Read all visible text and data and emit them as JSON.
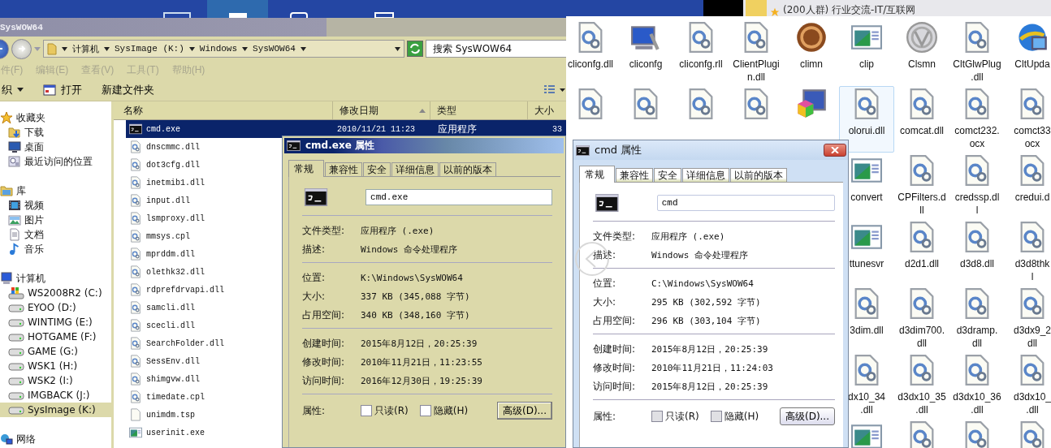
{
  "taskbar": {
    "notification": "(200人群) 行业交流-IT/互联网"
  },
  "explorer": {
    "title": "SysWOW64",
    "breadcrumbs": [
      "计算机",
      "SysImage (K:)",
      "Windows",
      "SysWOW64"
    ],
    "search": {
      "placeholder": "搜索 SysWOW64"
    },
    "menu": [
      {
        "label": "件(F)",
        "disabled": true
      },
      {
        "label": "编辑(E)",
        "disabled": true
      },
      {
        "label": "查看(V)",
        "disabled": true
      },
      {
        "label": "工具(T)",
        "disabled": true
      },
      {
        "label": "帮助(H)",
        "disabled": true
      }
    ],
    "toolbar": [
      {
        "label": "织",
        "kind": "dropdown"
      },
      {
        "label": "打开",
        "kind": "open"
      },
      {
        "label": "新建文件夹",
        "kind": "plain"
      }
    ],
    "nav": [
      {
        "label": "收藏夹",
        "kind": "favorites",
        "selected": false,
        "children": [
          {
            "label": "下载",
            "kind": "download",
            "selected": false
          },
          {
            "label": "桌面",
            "kind": "desktop",
            "selected": false
          },
          {
            "label": "最近访问的位置",
            "kind": "recent",
            "selected": false
          }
        ]
      },
      {
        "label": "库",
        "kind": "library",
        "selected": false,
        "children": [
          {
            "label": "视频",
            "kind": "video",
            "selected": false
          },
          {
            "label": "图片",
            "kind": "picture",
            "selected": false
          },
          {
            "label": "文档",
            "kind": "document",
            "selected": false
          },
          {
            "label": "音乐",
            "kind": "music",
            "selected": false
          }
        ]
      },
      {
        "label": "计算机",
        "kind": "computer",
        "selected": false,
        "children": [
          {
            "label": "WS2008R2 (C:)",
            "kind": "sysdrive",
            "selected": false
          },
          {
            "label": "EYOO (D:)",
            "kind": "drive",
            "selected": false
          },
          {
            "label": "WINTIMG (E:)",
            "kind": "drive",
            "selected": false
          },
          {
            "label": "HOTGAME (F:)",
            "kind": "drive",
            "selected": false
          },
          {
            "label": "GAME (G:)",
            "kind": "drive",
            "selected": false
          },
          {
            "label": "WSK1 (H:)",
            "kind": "drive",
            "selected": false
          },
          {
            "label": "WSK2 (I:)",
            "kind": "drive",
            "selected": false
          },
          {
            "label": "IMGBACK (J:)",
            "kind": "drive",
            "selected": false
          },
          {
            "label": "SysImage (K:)",
            "kind": "drive",
            "selected": true
          }
        ]
      },
      {
        "label": "网络",
        "kind": "network",
        "selected": false
      }
    ],
    "columns": [
      {
        "label": "名称",
        "sorted": false
      },
      {
        "label": "修改日期",
        "sorted": true
      },
      {
        "label": "类型",
        "sorted": false
      },
      {
        "label": "大小",
        "sorted": false
      }
    ],
    "files": [
      {
        "name": "cmd.exe",
        "kind": "console",
        "selected": true,
        "date": "2010/11/21 11:23",
        "type": "应用程序",
        "size": "33"
      },
      {
        "name": "dnscmmc.dll",
        "kind": "dll",
        "selected": false
      },
      {
        "name": "dot3cfg.dll",
        "kind": "dll",
        "selected": false
      },
      {
        "name": "inetmib1.dll",
        "kind": "dll",
        "selected": false
      },
      {
        "name": "input.dll",
        "kind": "dll",
        "selected": false
      },
      {
        "name": "lsmproxy.dll",
        "kind": "dll",
        "selected": false
      },
      {
        "name": "mmsys.cpl",
        "kind": "dll",
        "selected": false
      },
      {
        "name": "mprddm.dll",
        "kind": "dll",
        "selected": false
      },
      {
        "name": "olethk32.dll",
        "kind": "dll",
        "selected": false
      },
      {
        "name": "rdprefdrvapi.dll",
        "kind": "dll",
        "selected": false
      },
      {
        "name": "samcli.dll",
        "kind": "dll",
        "selected": false
      },
      {
        "name": "scecli.dll",
        "kind": "dll",
        "selected": false
      },
      {
        "name": "SearchFolder.dll",
        "kind": "dll",
        "selected": false
      },
      {
        "name": "SessEnv.dll",
        "kind": "dll",
        "selected": false
      },
      {
        "name": "shimgvw.dll",
        "kind": "dll",
        "selected": false
      },
      {
        "name": "timedate.cpl",
        "kind": "dll",
        "selected": false
      },
      {
        "name": "unimdm.tsp",
        "kind": "blank",
        "selected": false
      },
      {
        "name": "userinit.exe",
        "kind": "window",
        "selected": false
      }
    ]
  },
  "dialogs": [
    {
      "kind": "classic",
      "title": "cmd.exe 属性",
      "tabs": [
        {
          "label": "常规",
          "selected": true
        },
        {
          "label": "兼容性",
          "selected": false
        },
        {
          "label": "安全",
          "selected": false
        },
        {
          "label": "详细信息",
          "selected": false
        },
        {
          "label": "以前的版本",
          "selected": false
        }
      ],
      "name": "cmd.exe",
      "sections": [
        [
          {
            "label": "文件类型:",
            "value": "应用程序 (.exe)"
          },
          {
            "label": "描述:",
            "value": "Windows 命令处理程序"
          }
        ],
        [
          {
            "label": "位置:",
            "value": "K:\\Windows\\SysWOW64"
          },
          {
            "label": "大小:",
            "value": "337 KB (345,088 字节)"
          },
          {
            "label": "占用空间:",
            "value": "340 KB (348,160 字节)"
          }
        ],
        [
          {
            "label": "创建时间:",
            "value": "2015年8月12日，20:25:39"
          },
          {
            "label": "修改时间:",
            "value": "2010年11月21日，11:23:55"
          },
          {
            "label": "访问时间:",
            "value": "2016年12月30日，19:25:39"
          }
        ]
      ],
      "attributes_label": "属性:",
      "checkboxes": [
        {
          "label": "只读(R)",
          "checked": false
        },
        {
          "label": "隐藏(H)",
          "checked": false
        }
      ],
      "advanced_button": "高级(D)..."
    },
    {
      "kind": "basic",
      "title": "cmd 属性",
      "tabs": [
        {
          "label": "常规",
          "selected": true
        },
        {
          "label": "兼容性",
          "selected": false
        },
        {
          "label": "安全",
          "selected": false
        },
        {
          "label": "详细信息",
          "selected": false
        },
        {
          "label": "以前的版本",
          "selected": false
        }
      ],
      "name": "cmd",
      "sections": [
        [
          {
            "label": "文件类型:",
            "value": "应用程序 (.exe)"
          },
          {
            "label": "描述:",
            "value": "Windows 命令处理程序"
          }
        ],
        [
          {
            "label": "位置:",
            "value": "C:\\Windows\\SysWOW64"
          },
          {
            "label": "大小:",
            "value": "295 KB (302,592 字节)"
          },
          {
            "label": "占用空间:",
            "value": "296 KB (303,104 字节)"
          }
        ],
        [
          {
            "label": "创建时间:",
            "value": "2015年8月12日，20:25:39"
          },
          {
            "label": "修改时间:",
            "value": "2010年11月21日，11:24:03"
          },
          {
            "label": "访问时间:",
            "value": "2015年8月12日，20:25:39"
          }
        ]
      ],
      "attributes_label": "属性:",
      "checkboxes": [
        {
          "label": "只读(R)",
          "checked": false
        },
        {
          "label": "隐藏(H)",
          "checked": false
        }
      ],
      "advanced_button": "高级(D)..."
    }
  ],
  "icon_view": {
    "rows": [
      [
        {
          "label": "cliconfg.dll",
          "kind": "dll",
          "selected": false
        },
        {
          "label": "cliconfg",
          "kind": "tool",
          "selected": false
        },
        {
          "label": "cliconfg.rll",
          "kind": "dll",
          "selected": false
        },
        {
          "label": "ClientPlugi\nn.dll",
          "kind": "dll",
          "selected": false
        },
        {
          "label": "climn",
          "kind": "emblem",
          "selected": false
        },
        {
          "label": "clip",
          "kind": "window",
          "selected": false
        },
        {
          "label": "Clsmn",
          "kind": "badge",
          "selected": false
        },
        {
          "label": "CltGlwPlug\n.dll",
          "kind": "dll",
          "selected": false
        },
        {
          "label": "CltUpda",
          "kind": "globe",
          "selected": false
        }
      ],
      [
        {
          "kind": "dll",
          "selected": false
        },
        {
          "kind": "dll",
          "selected": false
        },
        {
          "kind": "dll",
          "selected": false
        },
        {
          "kind": "dll",
          "selected": false
        },
        {
          "kind": "cube",
          "selected": false
        },
        {
          "label": "olorui.dll",
          "kind": "dll",
          "selected": true
        },
        {
          "label": "comcat.dll",
          "kind": "dll",
          "selected": false
        },
        {
          "label": "comct232.\nocx",
          "kind": "dll",
          "selected": false
        },
        {
          "label": "comct33\nocx",
          "kind": "dll",
          "selected": false
        }
      ],
      [
        {
          "label": "convert",
          "kind": "window",
          "selected": false
        },
        {
          "label": "CPFilters.d\nll",
          "kind": "dll",
          "selected": false
        },
        {
          "label": "credssp.dl\nl",
          "kind": "dll",
          "selected": false
        },
        {
          "label": "credui.d",
          "kind": "dll",
          "selected": false
        }
      ],
      [
        {
          "label": "ttunesvr",
          "kind": "window",
          "selected": false
        },
        {
          "label": "d2d1.dll",
          "kind": "dll",
          "selected": false
        },
        {
          "label": "d3d8.dll",
          "kind": "dll",
          "selected": false
        },
        {
          "label": "d3d8thk\nl",
          "kind": "dll",
          "selected": false
        }
      ],
      [
        {
          "label": "3dim.dll",
          "kind": "dll",
          "selected": false
        },
        {
          "label": "d3dim700.\ndll",
          "kind": "dll",
          "selected": false
        },
        {
          "label": "d3dramp.\ndll",
          "kind": "dll",
          "selected": false
        },
        {
          "label": "d3dx9_2\ndll",
          "kind": "dll",
          "selected": false
        }
      ],
      [
        {
          "label": "dx10_34\n.dll",
          "kind": "dll",
          "selected": false
        },
        {
          "label": "d3dx10_35\n.dll",
          "kind": "dll",
          "selected": false
        },
        {
          "label": "d3dx10_36\n.dll",
          "kind": "dll",
          "selected": false
        },
        {
          "label": "d3dx10_\n.dll",
          "kind": "dll",
          "selected": false
        }
      ],
      [
        {
          "kind": "window",
          "selected": false
        },
        {
          "kind": "dll",
          "selected": false
        },
        {
          "kind": "dll",
          "selected": false
        },
        {
          "kind": "dll",
          "selected": false
        }
      ]
    ]
  }
}
